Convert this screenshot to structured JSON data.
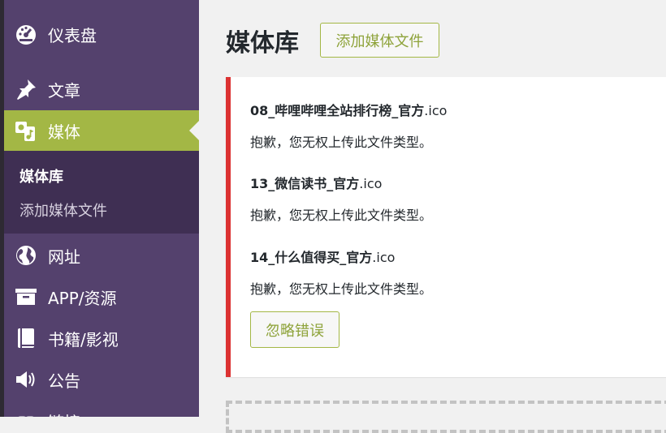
{
  "sidebar": {
    "items": [
      {
        "label": "仪表盘",
        "icon": "dashboard-icon"
      },
      {
        "label": "文章",
        "icon": "pushpin-icon"
      },
      {
        "label": "媒体",
        "icon": "media-icon",
        "active": true
      },
      {
        "label": "网址",
        "icon": "globe-icon"
      },
      {
        "label": "APP/资源",
        "icon": "archive-icon"
      },
      {
        "label": "书籍/影视",
        "icon": "book-icon"
      },
      {
        "label": "公告",
        "icon": "megaphone-icon"
      },
      {
        "label": "链接",
        "icon": "link-icon"
      }
    ],
    "submenu": [
      {
        "label": "媒体库",
        "current": true
      },
      {
        "label": "添加媒体文件"
      }
    ]
  },
  "header": {
    "title": "媒体库",
    "add_button": "添加媒体文件"
  },
  "notice": {
    "errors": [
      {
        "file_prefix": "08_哔哩哔哩全站排行榜_官方",
        "file_ext": ".ico",
        "message": "抱歉，您无权上传此文件类型。"
      },
      {
        "file_prefix": "13_微信读书_官方",
        "file_ext": ".ico",
        "message": "抱歉，您无权上传此文件类型。"
      },
      {
        "file_prefix": "14_什么值得买_官方",
        "file_ext": ".ico",
        "message": "抱歉，您无权上传此文件类型。"
      }
    ],
    "dismiss_button": "忽略错误"
  },
  "colors": {
    "sidebar_bg": "#54416d",
    "submenu_bg": "#3f2f53",
    "active_bg": "#a3b745",
    "accent_text": "#8ea33a",
    "error_border": "#dc3232"
  }
}
